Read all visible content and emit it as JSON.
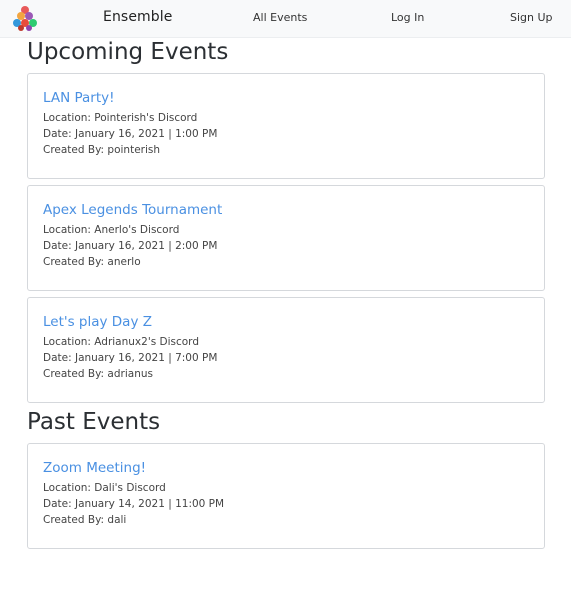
{
  "nav": {
    "brand": "Ensemble",
    "links": [
      {
        "label": "All Events"
      },
      {
        "label": "Log In"
      },
      {
        "label": "Sign Up"
      }
    ]
  },
  "sections": {
    "upcoming_title": "Upcoming Events",
    "past_title": "Past Events"
  },
  "upcoming_events": [
    {
      "title": "LAN Party!",
      "location": "Location: Pointerish's Discord",
      "date": "Date: January 16, 2021 | 1:00 PM",
      "created_by": "Created By: pointerish"
    },
    {
      "title": "Apex Legends Tournament",
      "location": "Location: Anerlo's Discord",
      "date": "Date: January 16, 2021 | 2:00 PM",
      "created_by": "Created By: anerlo"
    },
    {
      "title": "Let's play Day Z",
      "location": "Location: Adrianux2's Discord",
      "date": "Date: January 16, 2021 | 7:00 PM",
      "created_by": "Created By: adrianus"
    }
  ],
  "past_events": [
    {
      "title": "Zoom Meeting!",
      "location": "Location: Dali's Discord",
      "date": "Date: January 14, 2021 | 11:00 PM",
      "created_by": "Created By: dali"
    }
  ],
  "colors": {
    "link": "#4a90e2",
    "navbar_bg": "#f8f9fa",
    "card_border": "#d5d8dc"
  },
  "icons": {
    "logo": "colored-spheres-pyramid-logo"
  }
}
